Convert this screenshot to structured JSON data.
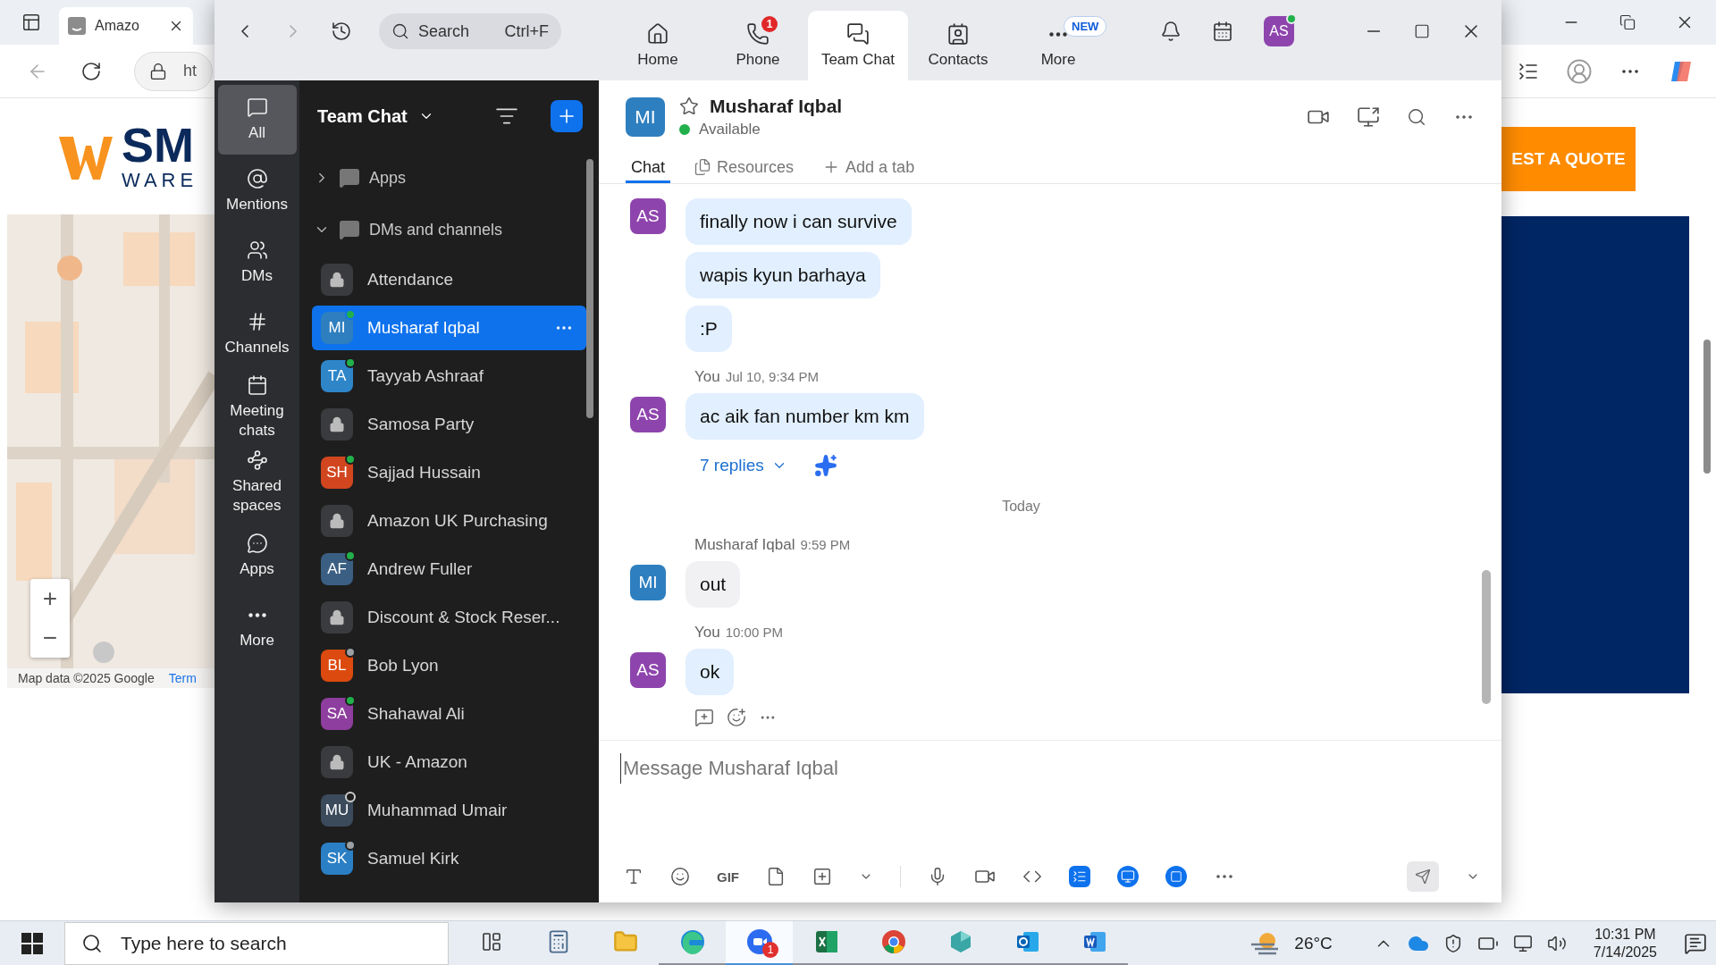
{
  "browser": {
    "tab": {
      "title": "Amazo"
    },
    "address": {
      "value": "ht"
    },
    "page": {
      "logo_text": "SM",
      "logo_subtext": "WARE",
      "map_attribution": "Map data ©2025 Google",
      "map_terms": "Term",
      "map_zoom_in": "+",
      "map_zoom_out": "−",
      "quote_button": "EST A QUOTE"
    }
  },
  "window": {
    "nav": {
      "search": {
        "placeholder": "Search",
        "shortcut": "Ctrl+F"
      },
      "tabs": [
        {
          "label": "Home",
          "kind": "home",
          "selected": false
        },
        {
          "label": "Phone",
          "kind": "phone",
          "badge": "1",
          "selected": false
        },
        {
          "label": "Team Chat",
          "kind": "chat",
          "selected": true
        },
        {
          "label": "Contacts",
          "kind": "contacts",
          "selected": false
        },
        {
          "label": "More",
          "kind": "more",
          "badge": "NEW",
          "selected": false
        }
      ],
      "user": {
        "initials": "AS",
        "color": "#8e44ad",
        "online": true
      }
    },
    "rail": [
      {
        "label": "All",
        "kind": "all",
        "selected": true
      },
      {
        "label": "Mentions",
        "kind": "mentions",
        "selected": false
      },
      {
        "label": "DMs",
        "kind": "dms",
        "selected": false
      },
      {
        "label": "Channels",
        "kind": "channels",
        "selected": false
      },
      {
        "label": "Meeting chats",
        "kind": "meetings",
        "selected": false
      },
      {
        "label": "Shared spaces",
        "kind": "shared",
        "selected": false
      },
      {
        "label": "Apps",
        "kind": "apps",
        "selected": false
      },
      {
        "label": "More",
        "kind": "more",
        "selected": false
      }
    ],
    "list": {
      "title": "Team Chat",
      "sections": [
        {
          "label": "Apps",
          "expanded": false
        },
        {
          "label": "DMs and channels",
          "expanded": true,
          "children": [
            {
              "kind": "channel",
              "name": "Attendance",
              "selected": false
            },
            {
              "kind": "person",
              "name": "Musharaf Iqbal",
              "initials": "MI",
              "color": "#2e7fbf",
              "online": true,
              "away": false,
              "selected": true
            },
            {
              "kind": "person",
              "name": "Tayyab Ashraaf",
              "initials": "TA",
              "color": "#2e86c9",
              "online": true,
              "away": false,
              "selected": false
            },
            {
              "kind": "channel",
              "name": "Samosa Party",
              "selected": false
            },
            {
              "kind": "person",
              "name": "Sajjad Hussain",
              "initials": "SH",
              "color": "#d2461f",
              "online": true,
              "away": false,
              "selected": false
            },
            {
              "kind": "channel",
              "name": "Amazon UK Purchasing",
              "selected": false
            },
            {
              "kind": "person",
              "name": "Andrew Fuller",
              "initials": "AF",
              "color": "#3a5f82",
              "online": true,
              "away": false,
              "selected": false
            },
            {
              "kind": "channel",
              "name": "Discount & Stock Reser...",
              "selected": false
            },
            {
              "kind": "person",
              "name": "Bob Lyon",
              "initials": "BL",
              "color": "#dc4a0f",
              "online": false,
              "away": true,
              "selected": false
            },
            {
              "kind": "person",
              "name": "Shahawal Ali",
              "initials": "SA",
              "color": "#8e3e9e",
              "online": true,
              "away": false,
              "selected": false
            },
            {
              "kind": "channel",
              "name": "UK - Amazon",
              "selected": false
            },
            {
              "kind": "person",
              "name": "Muhammad Umair",
              "initials": "MU",
              "color": "#3b4b5c",
              "online": false,
              "away": false,
              "selected": false
            },
            {
              "kind": "person",
              "name": "Samuel Kirk",
              "initials": "SK",
              "color": "#2b7fc4",
              "online": false,
              "away": true,
              "selected": false
            }
          ]
        }
      ]
    },
    "conversation": {
      "contact": {
        "name": "Musharaf Iqbal",
        "initials": "MI",
        "color": "#2e7fbf",
        "presence": "Available",
        "online": true
      },
      "tabs": [
        {
          "label": "Chat",
          "kind": "chat",
          "selected": true
        },
        {
          "label": "Resources",
          "kind": "resources",
          "selected": false
        },
        {
          "label": "Add a tab",
          "kind": "add",
          "selected": false
        }
      ],
      "timeline": [
        {
          "kind": "group",
          "mine": true,
          "initials": "AS",
          "color": "#8e44ad",
          "messages": [
            "finally now i can survive",
            "wapis kyun barhaya",
            ":P"
          ]
        },
        {
          "kind": "group",
          "mine": true,
          "sender": "You",
          "time": "Jul 10, 9:34 PM",
          "initials": "AS",
          "color": "#8e44ad",
          "messages": [
            "ac aik fan number km km"
          ],
          "replies": "7 replies"
        },
        {
          "kind": "divider",
          "label": "Today"
        },
        {
          "kind": "group",
          "mine": false,
          "sender": "Musharaf Iqbal",
          "time": "9:59 PM",
          "initials": "MI",
          "color": "#2e7fbf",
          "messages": [
            "out"
          ]
        },
        {
          "kind": "group",
          "mine": true,
          "sender": "You",
          "time": "10:00 PM",
          "initials": "AS",
          "color": "#8e44ad",
          "messages": [
            "ok"
          ],
          "actions": true
        }
      ]
    },
    "composer": {
      "placeholder": "Message Musharaf Iqbal",
      "gif_label": "GIF"
    }
  },
  "taskbar": {
    "search": {
      "placeholder": "Type here to search"
    },
    "apps": [
      {
        "kind": "taskview",
        "running": false,
        "active": false
      },
      {
        "kind": "calculator",
        "running": false,
        "active": false
      },
      {
        "kind": "explorer",
        "running": false,
        "active": false
      },
      {
        "kind": "edge",
        "running": true,
        "active": false
      },
      {
        "kind": "zoom",
        "running": true,
        "active": true,
        "badge": "1"
      },
      {
        "kind": "excel",
        "running": true,
        "active": false
      },
      {
        "kind": "chrome",
        "running": true,
        "active": false
      },
      {
        "kind": "app",
        "running": true,
        "active": false
      },
      {
        "kind": "outlook",
        "running": true,
        "active": false
      },
      {
        "kind": "word",
        "running": true,
        "active": false
      }
    ],
    "weather": "26°C",
    "time": "10:31 PM",
    "date": "7/14/2025"
  }
}
